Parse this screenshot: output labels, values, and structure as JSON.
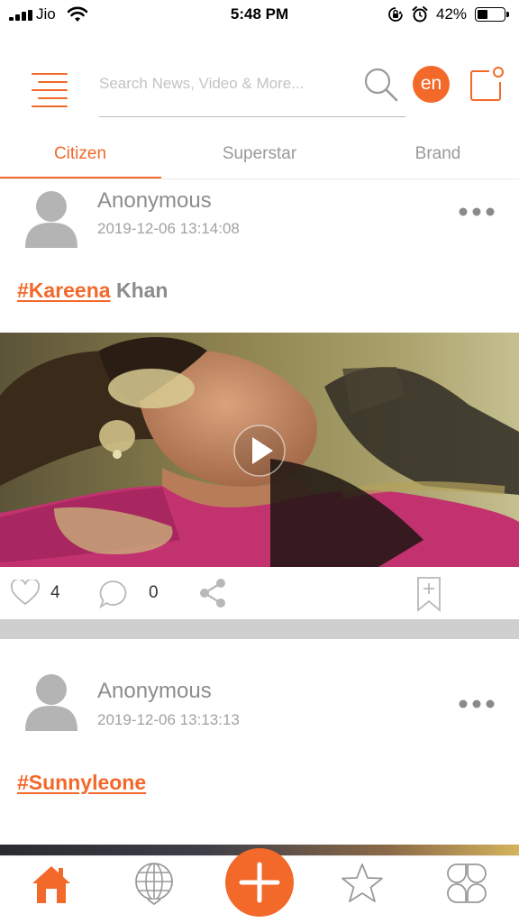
{
  "status_bar": {
    "carrier": "Jio",
    "time": "5:48 PM",
    "battery_percent": "42%",
    "battery_level": 0.42,
    "icons": [
      "signal-bars-icon",
      "wifi-icon",
      "orientation-lock-icon",
      "alarm-icon",
      "battery-icon"
    ]
  },
  "header": {
    "menu_icon": "hamburger-menu-icon",
    "search_placeholder": "Search News, Video & More...",
    "search_value": "",
    "search_icon": "search-icon",
    "language_label": "en",
    "compose_icon": "compose-icon"
  },
  "tabs": [
    {
      "label": "Citizen",
      "active": true
    },
    {
      "label": "Superstar",
      "active": false
    },
    {
      "label": "Brand",
      "active": false
    }
  ],
  "posts": [
    {
      "author": "Anonymous",
      "date": "2019-12-06 13:14:08",
      "hashtag": "#Kareena",
      "text": " Khan",
      "media": "video",
      "likes": "4",
      "comments": "0"
    },
    {
      "author": "Anonymous",
      "date": "2019-12-06 13:13:13",
      "hashtag": "#Sunnyleone",
      "text": ""
    }
  ],
  "bottom_nav": [
    {
      "icon": "home-icon",
      "active": true
    },
    {
      "icon": "globe-icon",
      "active": false
    },
    {
      "icon": "plus-icon",
      "active": false
    },
    {
      "icon": "star-icon",
      "active": false
    },
    {
      "icon": "grid-icon",
      "active": false
    }
  ],
  "colors": {
    "accent": "#f2692a",
    "muted_text": "#8d8d8d",
    "separator": "#cfcfcf"
  }
}
